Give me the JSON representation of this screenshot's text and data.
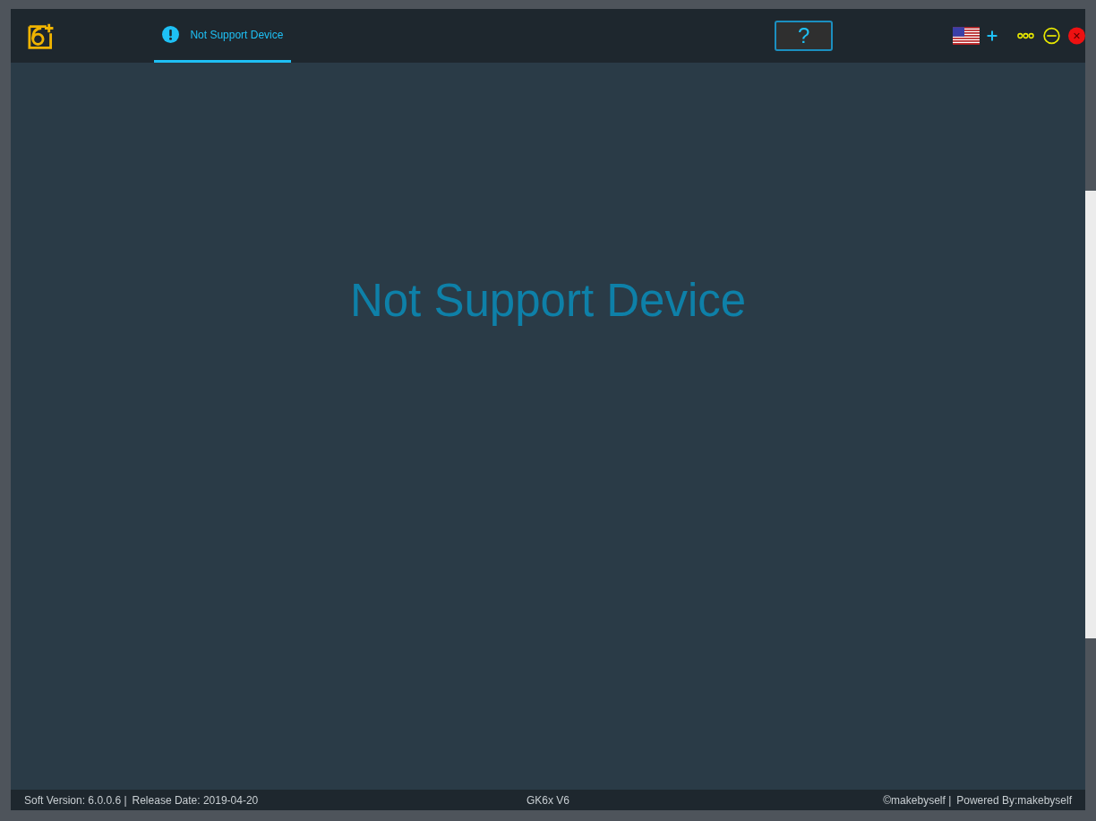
{
  "tabs": [
    {
      "label": "Not Support Device",
      "selected": true
    }
  ],
  "help_button": {
    "label": "?"
  },
  "main": {
    "message": "Not Support Device"
  },
  "status_bar": {
    "left": [
      "Soft Version: 6.0.0.6 |",
      "Release Date: 2019-04-20"
    ],
    "center": "GK6x V6",
    "right": [
      "©makebyself |",
      "Powered By:makebyself"
    ]
  }
}
